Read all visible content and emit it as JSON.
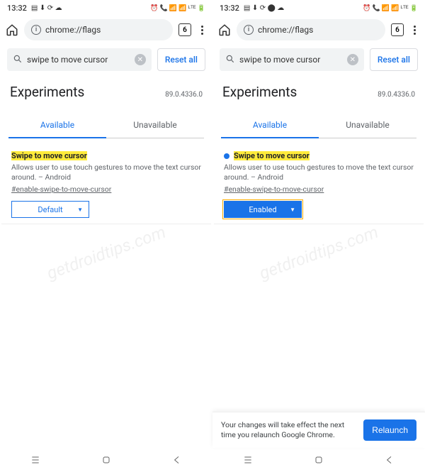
{
  "status": {
    "time": "13:32"
  },
  "toolbar": {
    "url": "chrome://flags",
    "tabcount": "6"
  },
  "search": {
    "query": "swipe to move cursor",
    "reset": "Reset all"
  },
  "header": {
    "title": "Experiments",
    "version": "89.0.4336.0"
  },
  "tabs": {
    "available": "Available",
    "unavailable": "Unavailable"
  },
  "flag": {
    "title": "Swipe to move cursor",
    "desc": "Allows user to use touch gestures to move the text cursor around. – Android",
    "id": "#enable-swipe-to-move-cursor",
    "default_label": "Default",
    "enabled_label": "Enabled"
  },
  "relaunch": {
    "msg": "Your changes will take effect the next time you relaunch Google Chrome.",
    "btn": "Relaunch"
  },
  "watermark": "getdroidtips.com"
}
